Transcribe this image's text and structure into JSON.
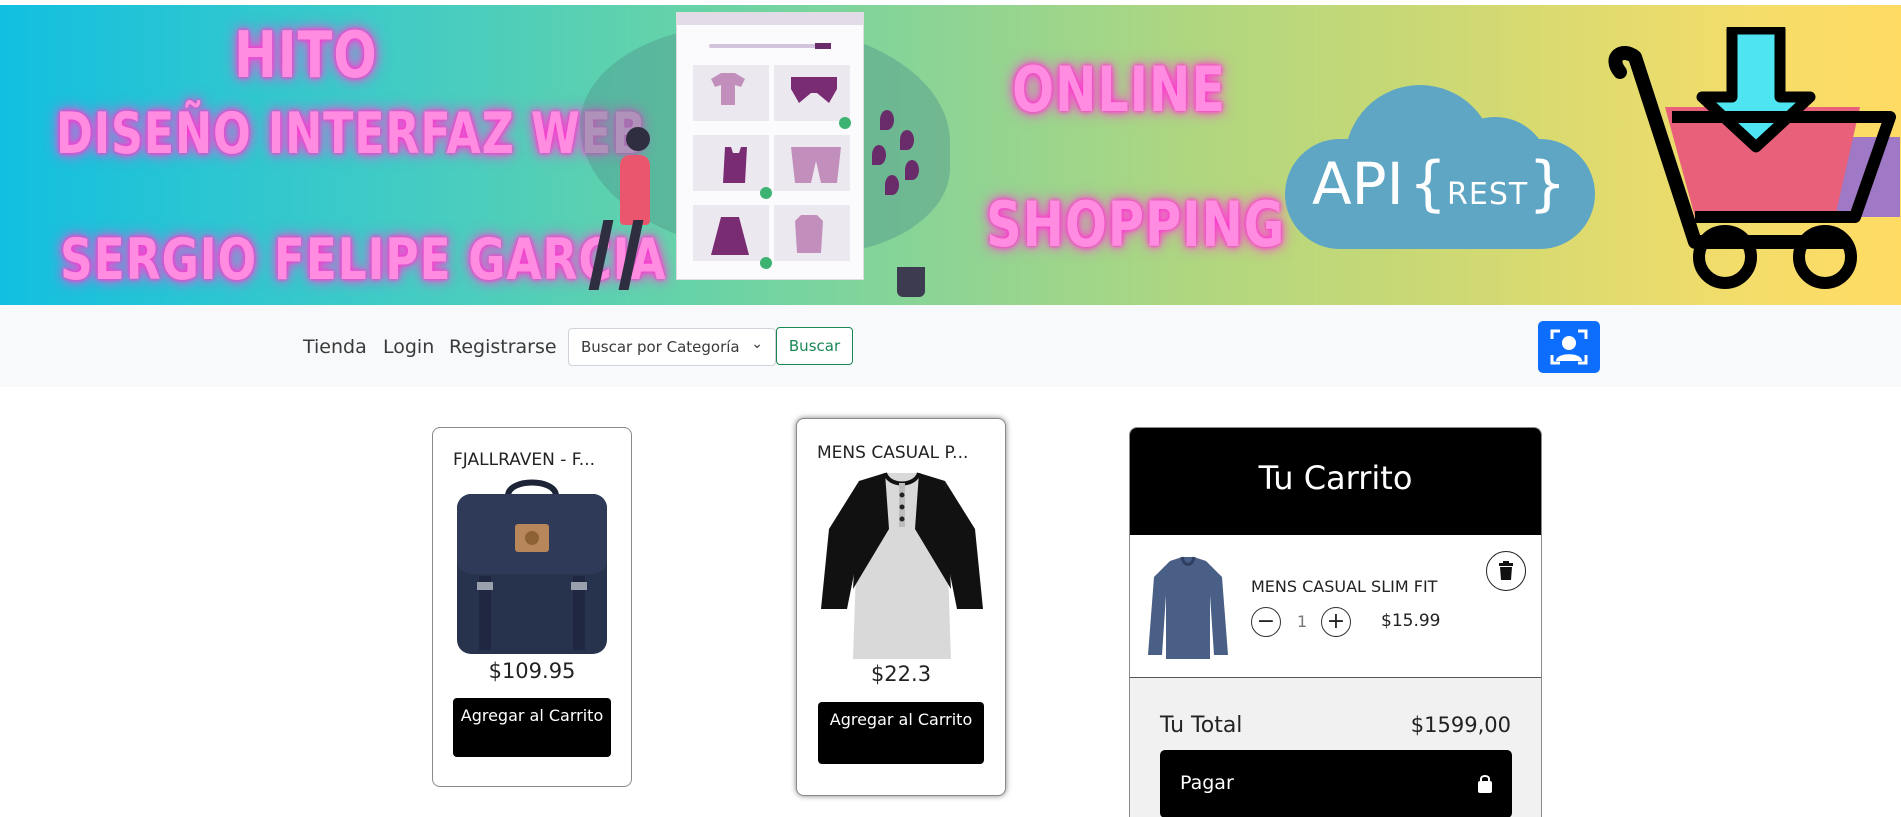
{
  "banner": {
    "line1": "HITO",
    "line2": "DISEÑO INTERFAZ WEB",
    "line3": "SERGIO FELIPE GARCIA",
    "line4": "ONLINE",
    "line5": "SHOPPING",
    "cloud_api": "API",
    "cloud_brace_open": "{",
    "cloud_rest": "REST",
    "cloud_brace_close": "}"
  },
  "navbar": {
    "links": [
      "Tienda",
      "Login",
      "Registrarse"
    ],
    "category_select": "Buscar por Categoría",
    "search_button": "Buscar",
    "user_button_icon": "user-scan-icon"
  },
  "products": [
    {
      "title": "FJALLRAVEN - F...",
      "price": "$109.95",
      "button": "Agregar al Carrito",
      "image": "backpack"
    },
    {
      "title": "MENS CASUAL P...",
      "price": "$22.3",
      "button": "Agregar al Carrito",
      "image": "raglan-tshirt"
    }
  ],
  "cart": {
    "title": "Tu Carrito",
    "items": [
      {
        "name": "MENS CASUAL SLIM FIT",
        "quantity": "1",
        "price": "$15.99",
        "image": "slim-fit-shirt"
      }
    ],
    "total_label": "Tu Total",
    "total_value": "$1599,00",
    "pay_button": "Pagar"
  },
  "colors": {
    "primary": "#0d6efd",
    "success": "#198754",
    "neon_pink": "#ff8ce0",
    "black": "#000000"
  }
}
